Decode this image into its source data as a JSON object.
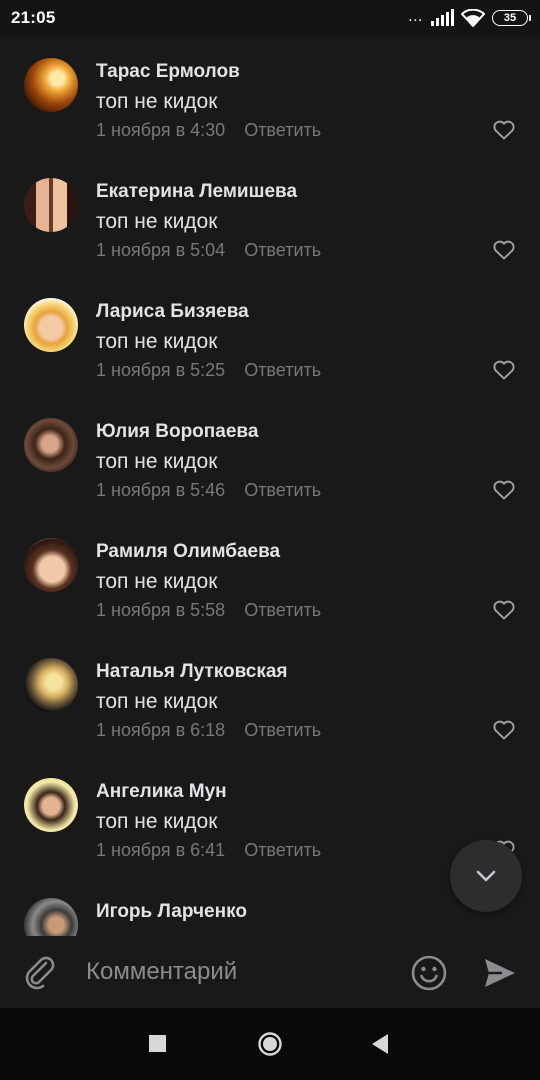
{
  "status_bar": {
    "time": "21:05",
    "dots": "...",
    "battery": "35",
    "icons": [
      "signal-icon",
      "wifi-icon",
      "battery-icon"
    ]
  },
  "comments": [
    {
      "author": "Тарас Ермолов",
      "text": "топ не кидок",
      "date": "1 ноября в 4:30",
      "reply": "Ответить",
      "avatar": "candle-photo"
    },
    {
      "author": "Екатерина Лемишева",
      "text": "топ не кидок",
      "date": "1 ноября в 5:04",
      "reply": "Ответить",
      "avatar": "two-girls-photo"
    },
    {
      "author": "Лариса Бизяева",
      "text": "топ не кидок",
      "date": "1 ноября в 5:25",
      "reply": "Ответить",
      "avatar": "blonde-girl-photo"
    },
    {
      "author": "Юлия Воропаева",
      "text": "топ не кидок",
      "date": "1 ноября в 5:46",
      "reply": "Ответить",
      "avatar": "dark-hair-girl-photo"
    },
    {
      "author": "Рамиля Олимбаева",
      "text": "топ не кидок",
      "date": "1 ноября в 5:58",
      "reply": "Ответить",
      "avatar": "smiling-girl-photo"
    },
    {
      "author": "Наталья Лутковская",
      "text": "топ не кидок",
      "date": "1 ноября в 6:18",
      "reply": "Ответить",
      "avatar": "blonde-dark-photo"
    },
    {
      "author": "Ангелика Мун",
      "text": "топ не кидок",
      "date": "1 ноября в 6:41",
      "reply": "Ответить",
      "avatar": "girl-portrait-photo"
    },
    {
      "author": "Игорь Ларченко",
      "text": "",
      "date": "",
      "reply": "",
      "avatar": "man-photo"
    }
  ],
  "composer": {
    "placeholder": "Комментарий"
  },
  "colors": {
    "background": "#19191a",
    "primary_text": "#e1e3e6",
    "secondary_text": "#76787a"
  }
}
